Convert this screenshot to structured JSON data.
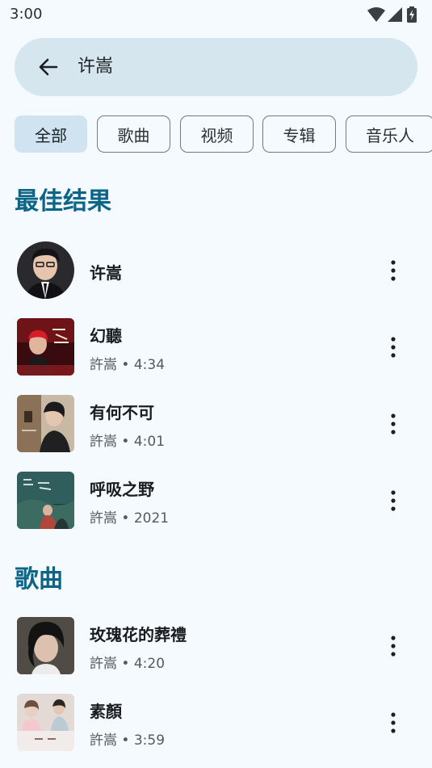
{
  "status": {
    "time": "3:00"
  },
  "search": {
    "query": "许嵩"
  },
  "filters": [
    "全部",
    "歌曲",
    "视频",
    "专辑",
    "音乐人"
  ],
  "sections": {
    "best": {
      "title": "最佳结果",
      "items": [
        {
          "title": "许嵩",
          "subtitle": ""
        },
        {
          "title": "幻聽",
          "subtitle": "許嵩 • 4:34"
        },
        {
          "title": "有何不可",
          "subtitle": "許嵩 • 4:01"
        },
        {
          "title": "呼吸之野",
          "subtitle": "許嵩 • 2021"
        }
      ]
    },
    "songs": {
      "title": "歌曲",
      "items": [
        {
          "title": "玫瑰花的葬禮",
          "subtitle": "許嵩 • 4:20"
        },
        {
          "title": "素顏",
          "subtitle": "許嵩 • 3:59"
        }
      ]
    }
  },
  "colors": {
    "background": "#f4faff",
    "accent": "#0c6486",
    "search_bg": "#d5e6ee",
    "chip_active": "#cfe4f0"
  },
  "icons": {
    "back": "arrow-left-icon",
    "more": "more-vertical-icon",
    "wifi": "wifi-icon",
    "signal": "signal-icon",
    "battery": "battery-charging-icon"
  }
}
